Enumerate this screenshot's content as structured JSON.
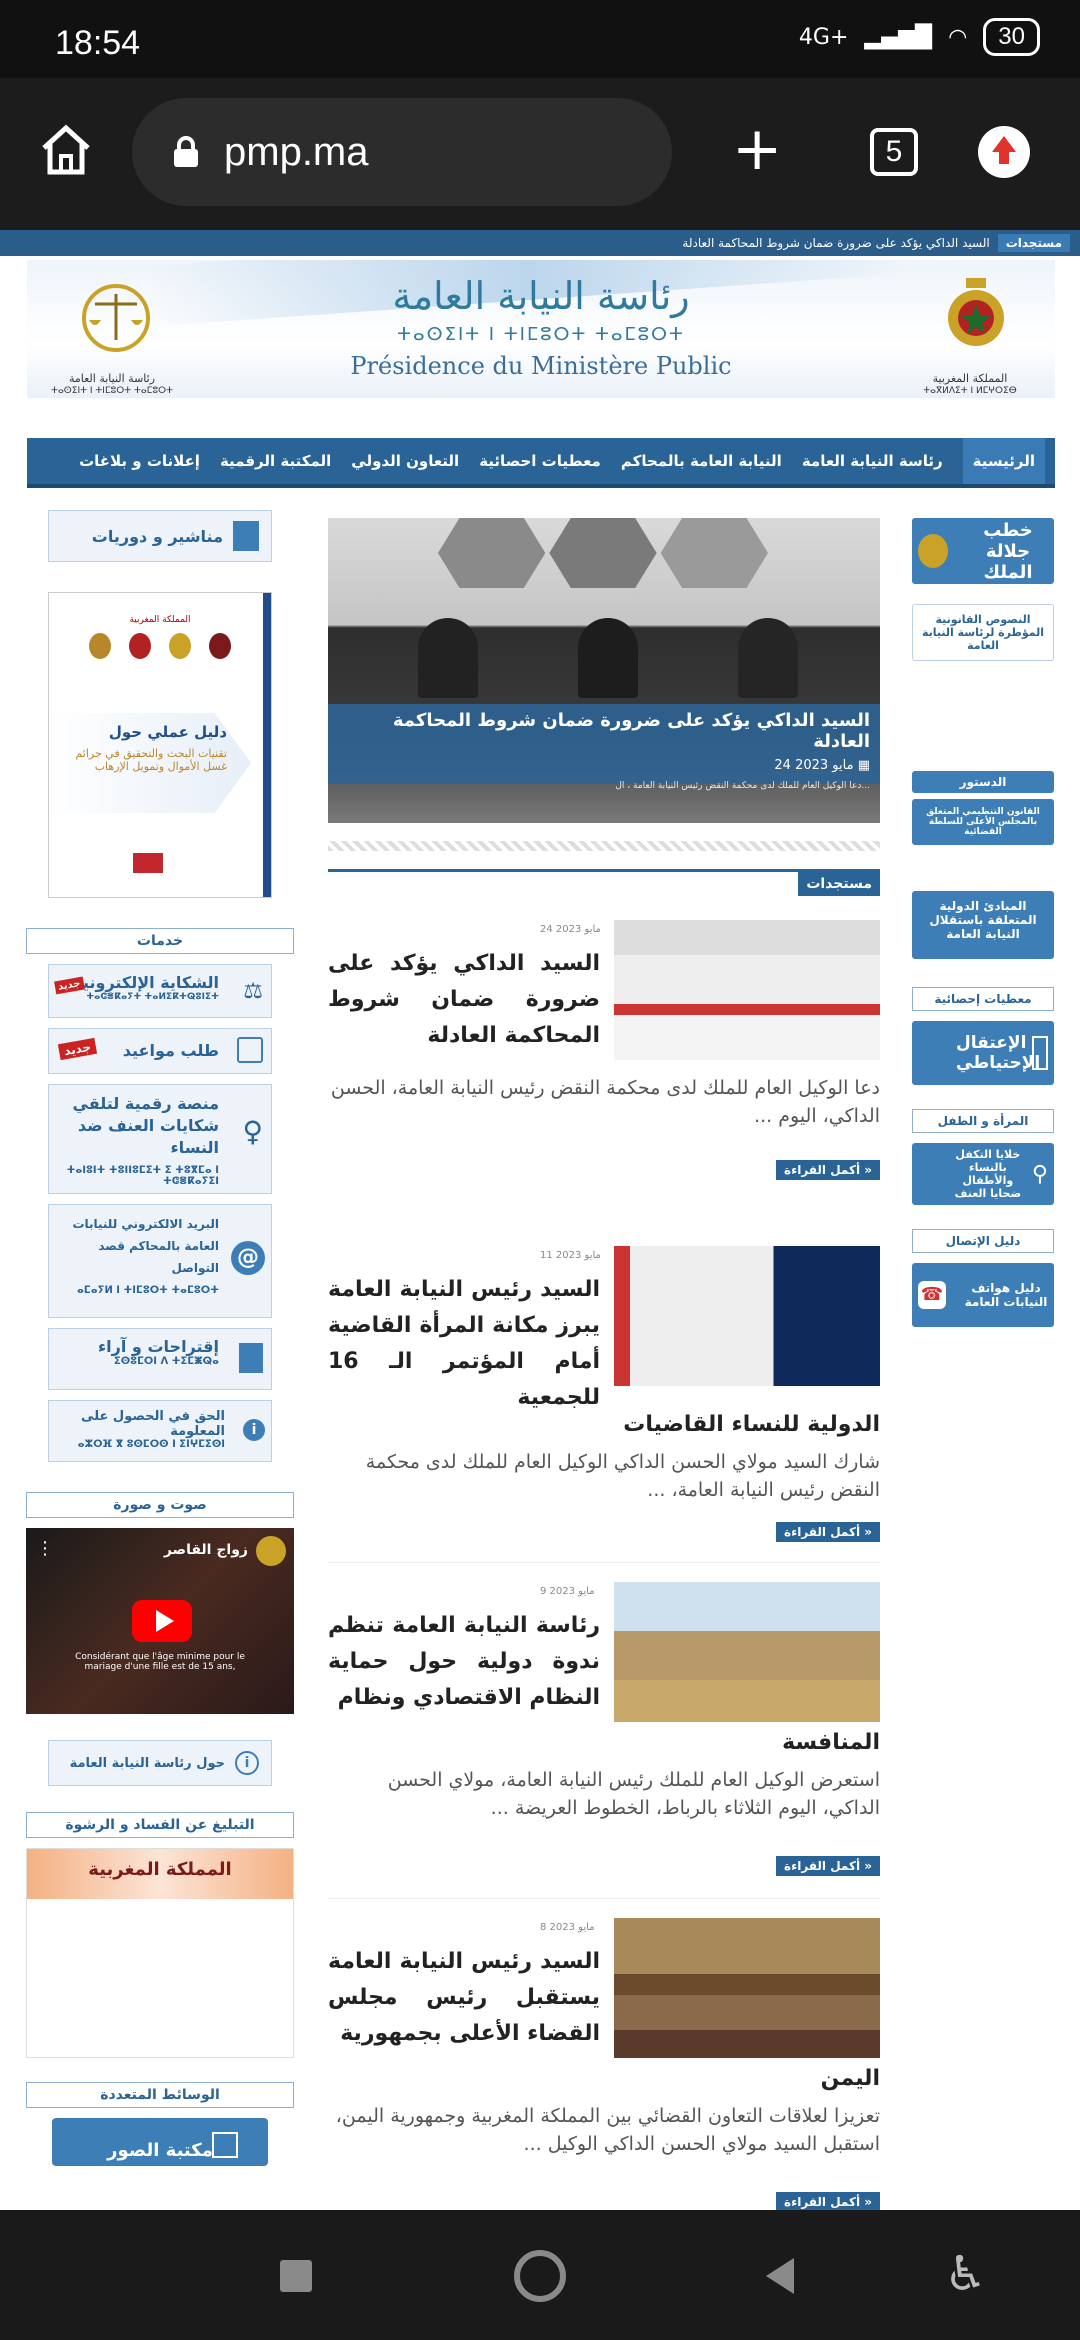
{
  "status": {
    "time": "18:54",
    "network": "4G+",
    "battery": "30"
  },
  "browser": {
    "url": "pmp.ma",
    "tab_count": "5"
  },
  "newsbar": {
    "label": "مستجدات",
    "headline": "السيد الداكي يؤكد على ضرورة ضمان شروط المحاكمة العادلة"
  },
  "banner": {
    "title_ar": "رئاسة النيابة العامة",
    "title_tf": "ⵜⴰⵙⵉⵏⵜ ⵏ ⵜⵏⵎⵓⵔⵜ ⵜⴰⵎⵓⵔⵜ",
    "title_fr": "Présidence du Ministère Public",
    "kingdom_ar": "المملكة المغربية",
    "kingdom_tf": "ⵜⴰⴳⵍⴷⵉⵜ ⵏ ⵍⵎⵖⵔⵉⴱ",
    "presidency_ar": "رئاسة النيابة العامة",
    "presidency_tf": "ⵜⴰⵙⵉⵏⵜ ⵏ ⵜⵏⵎⵓⵔⵜ ⵜⴰⵎⵓⵔⵜ"
  },
  "nav": [
    "الرئيسية",
    "رئاسة النيابة العامة",
    "النيابة العامة بالمحاكم",
    "معطيات احصائية",
    "التعاون الدولي",
    "المكتبة الرقمية",
    "إعلانات و بلاغات"
  ],
  "hero": {
    "title": "السيد الداكي يؤكد على ضرورة ضمان شروط المحاكمة العادلة",
    "date": "24 مايو 2023",
    "snippet": "دعا الوكيل العام للملك لدى محكمة النقض رئيس النيابة العامة ، ال..."
  },
  "latest_label": "مستجدات",
  "read_more": "أكمل القراءة »",
  "articles": [
    {
      "date": "24 مايو 2023",
      "title": "السيد الداكي يؤكد على ضرورة ضمان شروط المحاكمة العادلة",
      "title_cont": "",
      "body": "دعا الوكيل العام للملك لدى محكمة النقض رئيس النيابة العامة، الحسن الداكي، اليوم ..."
    },
    {
      "date": "11 مايو 2023",
      "title": "السيد رئيس النيابة العامة يبرز مكانة المرأة القاضية أمام المؤتمر الـ 16 للجمعية",
      "title_cont": "الدولية للنساء القاضيات",
      "body": "شارك السيد مولاي الحسن الداكي الوكيل العام للملك لدى محكمة النقض رئيس النيابة العامة، ..."
    },
    {
      "date": "9 مايو 2023",
      "title": "رئاسة النيابة العامة تنظم ندوة دولية حول حماية النظام الاقتصادي ونظام",
      "title_cont": "المنافسة",
      "body": "استعرض الوكيل العام للملك رئيس النيابة العامة، مولاي الحسن الداكي، اليوم الثلاثاء بالرباط، الخطوط العريضة ..."
    },
    {
      "date": "8 مايو 2023",
      "title": "السيد رئيس النيابة العامة يستقبل رئيس مجلس القضاء الأعلى بجمهورية",
      "title_cont": "اليمن",
      "body": "تعزيزا لعلاقات التعاون القضائي بين المملكة المغربية وجمهورية اليمن، استقبل السيد مولاي الحسن الداكي الوكيل ..."
    }
  ],
  "left": {
    "brochures": "مناشير و دوريات",
    "guide_kingdom": "المملكة المغربية",
    "guide_title": "دليل عملي حول",
    "guide_sub": "تقنيات البحث والتحقيق في جرائم غسل الأموال وتمويل الإرهاب",
    "services_head": "خدمات",
    "services": [
      {
        "label": "الشكاية الإلكترونية",
        "sub": "ⵜⴰⵛⴻⴽⴰⵢⵜ ⵜⴰⵍⵉⴽⵜⵕⵓⵏⵉⵜ",
        "badge": "جديد"
      },
      {
        "label": "طلب مواعيد",
        "sub": "",
        "badge": "جديد"
      },
      {
        "label": "منصة رقمية لتلقي شكايات العنف ضد النساء",
        "sub": "ⵜⴰⵏⵓⵏⵜ ⵜⵓⵏⵏⵓⵎⵉⵜ ⵉ ⵜⵓⴳⵎⴰ ⵏ ⵜⵛⴻⴽⴰⵢⵉⵏ",
        "badge": ""
      },
      {
        "label": "البريد الالكتروني للنيابات العامة بالمحاكم قصد التواصل",
        "sub": "ⴰⵎⴰⵢⵍ ⵏ ⵜⵏⵎⵓⵔⵜ ⵜⴰⵎⵓⵔⵜ",
        "badge": ""
      },
      {
        "label": "إقتراحات و آراء",
        "sub": "ⵉⵙⵓⵎⵔⵏ ⴷ ⵜⵉⵎⵥⵕⴰ",
        "badge": ""
      },
      {
        "label": "الحق في الحصول على المعلومة",
        "sub": "ⴰⵣⵔⴼ ⴳ ⵓⵙⵎⵔⵙ ⵏ ⵉⵏⵖⵎⵉⵙⵏ",
        "badge": ""
      }
    ],
    "audio_head": "صوت و صورة",
    "video_title": "زواج القاصر",
    "video_caption": "Considérant que l'âge minime pour le mariage d'une fille est de 15 ans,",
    "about": "حول رئاسة النيابة العامة",
    "report_head": "التبليغ عن الفساد و الرشوة",
    "report_kingdom": "المملكة المغربية",
    "media_head": "الوسائط المتعددة",
    "photo_lib": "مكتبة الصور"
  },
  "right": {
    "speech": "خطب جلالة الملك",
    "legal": "النصوص القانونية المؤطرة لرئاسة النيابة العامة",
    "constitution": "الدستور",
    "organic_law": "القانون التنظيمي المتعلق بالمجلس الأعلى للسلطة القضائية",
    "principles": "المبادئ الدولية المتعلقة باستقلال النيابة العامة",
    "stats_head": "معطيات إحصائية",
    "detention": "الإعتقال الإحتياطي",
    "women_head": "المرأة و الطفل",
    "women_cells": "خلايا التكفل بالنساء والأطفال ضحايا العنف",
    "contact_head": "دليل الإتصال",
    "phones": "دليل هواتف النيابات العامة"
  },
  "colors": {
    "primary": "#2a6496",
    "accent": "#3d7eb6",
    "badge": "#cc2222"
  }
}
